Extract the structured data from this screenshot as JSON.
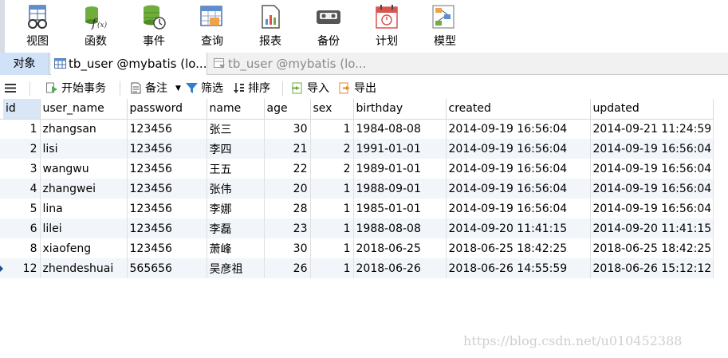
{
  "ribbon": {
    "buttons": [
      {
        "label": "视图",
        "icon": "view-icon"
      },
      {
        "label": "函数",
        "icon": "function-icon"
      },
      {
        "label": "事件",
        "icon": "event-icon"
      },
      {
        "label": "查询",
        "icon": "query-icon"
      },
      {
        "label": "报表",
        "icon": "report-icon"
      },
      {
        "label": "备份",
        "icon": "backup-icon"
      },
      {
        "label": "计划",
        "icon": "schedule-icon"
      },
      {
        "label": "模型",
        "icon": "model-icon"
      }
    ]
  },
  "tabs": {
    "objects_label": "对象",
    "active_label": "tb_user @mybatis (lo...",
    "inactive_label": "tb_user @mybatis (lo..."
  },
  "toolbar": {
    "begin_transaction": "开始事务",
    "memo": "备注",
    "filter": "筛选",
    "sort": "排序",
    "import": "导入",
    "export": "导出"
  },
  "grid": {
    "columns": [
      "id",
      "user_name",
      "password",
      "name",
      "age",
      "sex",
      "birthday",
      "created",
      "updated"
    ],
    "rows": [
      [
        "1",
        "zhangsan",
        "123456",
        "张三",
        "30",
        "1",
        "1984-08-08",
        "2014-09-19 16:56:04",
        "2014-09-21 11:24:59"
      ],
      [
        "2",
        "lisi",
        "123456",
        "李四",
        "21",
        "2",
        "1991-01-01",
        "2014-09-19 16:56:04",
        "2014-09-19 16:56:04"
      ],
      [
        "3",
        "wangwu",
        "123456",
        "王五",
        "22",
        "2",
        "1989-01-01",
        "2014-09-19 16:56:04",
        "2014-09-19 16:56:04"
      ],
      [
        "4",
        "zhangwei",
        "123456",
        "张伟",
        "20",
        "1",
        "1988-09-01",
        "2014-09-19 16:56:04",
        "2014-09-19 16:56:04"
      ],
      [
        "5",
        "lina",
        "123456",
        "李娜",
        "28",
        "1",
        "1985-01-01",
        "2014-09-19 16:56:04",
        "2014-09-19 16:56:04"
      ],
      [
        "6",
        "lilei",
        "123456",
        "李磊",
        "23",
        "1",
        "1988-08-08",
        "2014-09-20 11:41:15",
        "2014-09-20 11:41:15"
      ],
      [
        "8",
        "xiaofeng",
        "123456",
        "萧峰",
        "30",
        "1",
        "2018-06-25",
        "2018-06-25 18:42:25",
        "2018-06-25 18:42:25"
      ],
      [
        "12",
        "zhendeshuai",
        "565656",
        "吴彦祖",
        "26",
        "1",
        "2018-06-26",
        "2018-06-26 14:55:59",
        "2018-06-26 15:12:12"
      ]
    ]
  },
  "watermark": "https://blog.csdn.net/u010452388"
}
